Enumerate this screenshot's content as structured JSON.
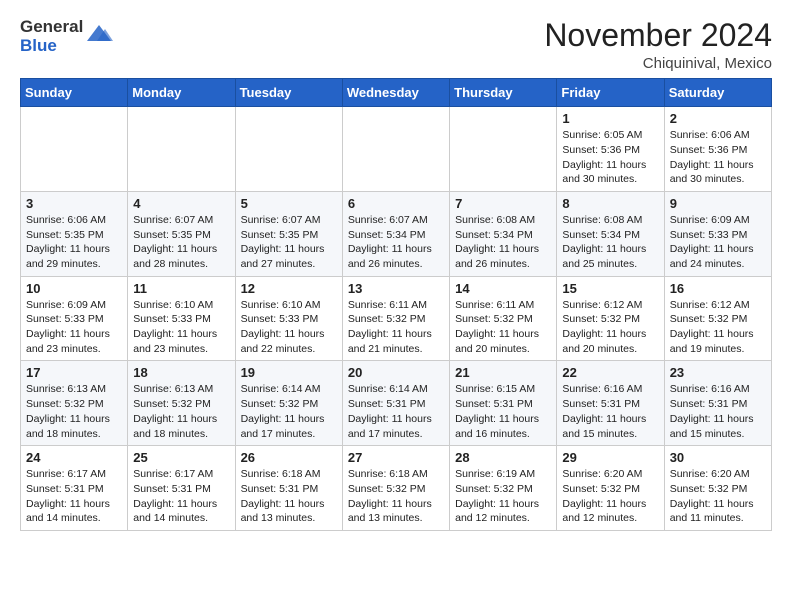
{
  "header": {
    "logo_general": "General",
    "logo_blue": "Blue",
    "month_title": "November 2024",
    "location": "Chiquinival, Mexico"
  },
  "weekdays": [
    "Sunday",
    "Monday",
    "Tuesday",
    "Wednesday",
    "Thursday",
    "Friday",
    "Saturday"
  ],
  "weeks": [
    [
      {
        "day": "",
        "info": ""
      },
      {
        "day": "",
        "info": ""
      },
      {
        "day": "",
        "info": ""
      },
      {
        "day": "",
        "info": ""
      },
      {
        "day": "",
        "info": ""
      },
      {
        "day": "1",
        "info": "Sunrise: 6:05 AM\nSunset: 5:36 PM\nDaylight: 11 hours and 30 minutes."
      },
      {
        "day": "2",
        "info": "Sunrise: 6:06 AM\nSunset: 5:36 PM\nDaylight: 11 hours and 30 minutes."
      }
    ],
    [
      {
        "day": "3",
        "info": "Sunrise: 6:06 AM\nSunset: 5:35 PM\nDaylight: 11 hours and 29 minutes."
      },
      {
        "day": "4",
        "info": "Sunrise: 6:07 AM\nSunset: 5:35 PM\nDaylight: 11 hours and 28 minutes."
      },
      {
        "day": "5",
        "info": "Sunrise: 6:07 AM\nSunset: 5:35 PM\nDaylight: 11 hours and 27 minutes."
      },
      {
        "day": "6",
        "info": "Sunrise: 6:07 AM\nSunset: 5:34 PM\nDaylight: 11 hours and 26 minutes."
      },
      {
        "day": "7",
        "info": "Sunrise: 6:08 AM\nSunset: 5:34 PM\nDaylight: 11 hours and 26 minutes."
      },
      {
        "day": "8",
        "info": "Sunrise: 6:08 AM\nSunset: 5:34 PM\nDaylight: 11 hours and 25 minutes."
      },
      {
        "day": "9",
        "info": "Sunrise: 6:09 AM\nSunset: 5:33 PM\nDaylight: 11 hours and 24 minutes."
      }
    ],
    [
      {
        "day": "10",
        "info": "Sunrise: 6:09 AM\nSunset: 5:33 PM\nDaylight: 11 hours and 23 minutes."
      },
      {
        "day": "11",
        "info": "Sunrise: 6:10 AM\nSunset: 5:33 PM\nDaylight: 11 hours and 23 minutes."
      },
      {
        "day": "12",
        "info": "Sunrise: 6:10 AM\nSunset: 5:33 PM\nDaylight: 11 hours and 22 minutes."
      },
      {
        "day": "13",
        "info": "Sunrise: 6:11 AM\nSunset: 5:32 PM\nDaylight: 11 hours and 21 minutes."
      },
      {
        "day": "14",
        "info": "Sunrise: 6:11 AM\nSunset: 5:32 PM\nDaylight: 11 hours and 20 minutes."
      },
      {
        "day": "15",
        "info": "Sunrise: 6:12 AM\nSunset: 5:32 PM\nDaylight: 11 hours and 20 minutes."
      },
      {
        "day": "16",
        "info": "Sunrise: 6:12 AM\nSunset: 5:32 PM\nDaylight: 11 hours and 19 minutes."
      }
    ],
    [
      {
        "day": "17",
        "info": "Sunrise: 6:13 AM\nSunset: 5:32 PM\nDaylight: 11 hours and 18 minutes."
      },
      {
        "day": "18",
        "info": "Sunrise: 6:13 AM\nSunset: 5:32 PM\nDaylight: 11 hours and 18 minutes."
      },
      {
        "day": "19",
        "info": "Sunrise: 6:14 AM\nSunset: 5:32 PM\nDaylight: 11 hours and 17 minutes."
      },
      {
        "day": "20",
        "info": "Sunrise: 6:14 AM\nSunset: 5:31 PM\nDaylight: 11 hours and 17 minutes."
      },
      {
        "day": "21",
        "info": "Sunrise: 6:15 AM\nSunset: 5:31 PM\nDaylight: 11 hours and 16 minutes."
      },
      {
        "day": "22",
        "info": "Sunrise: 6:16 AM\nSunset: 5:31 PM\nDaylight: 11 hours and 15 minutes."
      },
      {
        "day": "23",
        "info": "Sunrise: 6:16 AM\nSunset: 5:31 PM\nDaylight: 11 hours and 15 minutes."
      }
    ],
    [
      {
        "day": "24",
        "info": "Sunrise: 6:17 AM\nSunset: 5:31 PM\nDaylight: 11 hours and 14 minutes."
      },
      {
        "day": "25",
        "info": "Sunrise: 6:17 AM\nSunset: 5:31 PM\nDaylight: 11 hours and 14 minutes."
      },
      {
        "day": "26",
        "info": "Sunrise: 6:18 AM\nSunset: 5:31 PM\nDaylight: 11 hours and 13 minutes."
      },
      {
        "day": "27",
        "info": "Sunrise: 6:18 AM\nSunset: 5:32 PM\nDaylight: 11 hours and 13 minutes."
      },
      {
        "day": "28",
        "info": "Sunrise: 6:19 AM\nSunset: 5:32 PM\nDaylight: 11 hours and 12 minutes."
      },
      {
        "day": "29",
        "info": "Sunrise: 6:20 AM\nSunset: 5:32 PM\nDaylight: 11 hours and 12 minutes."
      },
      {
        "day": "30",
        "info": "Sunrise: 6:20 AM\nSunset: 5:32 PM\nDaylight: 11 hours and 11 minutes."
      }
    ]
  ]
}
